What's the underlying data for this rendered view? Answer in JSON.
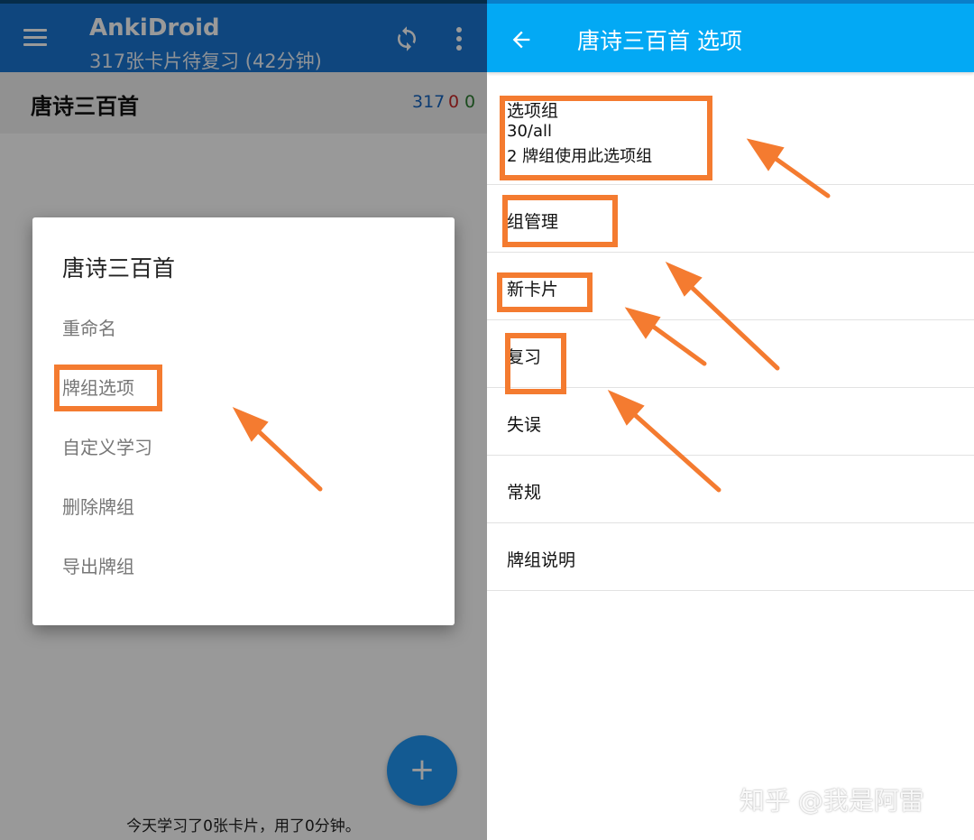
{
  "left_screen": {
    "app_bar": {
      "title": "AnkiDroid",
      "subtitle": "317张卡片待复习 (42分钟)",
      "menu_icon": "menu-icon",
      "sync_icon": "sync-icon",
      "more_icon": "more-vert-icon"
    },
    "deck": {
      "name": "唐诗三百首",
      "due_count": "317",
      "new_count": "0",
      "learning_count": "0"
    },
    "dialog": {
      "title": "唐诗三百首",
      "items": [
        {
          "label": "重命名"
        },
        {
          "label": "牌组选项"
        },
        {
          "label": "自定义学习"
        },
        {
          "label": "删除牌组"
        },
        {
          "label": "导出牌组"
        }
      ]
    },
    "footer_text": "今天学习了0张卡片，用了0分钟。",
    "fab_label": "+"
  },
  "right_screen": {
    "app_bar": {
      "title": "唐诗三百首 选项",
      "back_icon": "arrow-back-icon"
    },
    "options_group": {
      "title": "选项组",
      "value": "30/all",
      "summary": "2 牌组使用此选项组"
    },
    "sections": [
      {
        "label": "组管理"
      },
      {
        "label": "新卡片"
      },
      {
        "label": "复习"
      },
      {
        "label": "失误"
      },
      {
        "label": "常规"
      },
      {
        "label": "牌组说明"
      }
    ]
  },
  "watermark": "知乎 @我是阿雷",
  "colors": {
    "left_app_bar": "#1976d2",
    "right_app_bar": "#03a9f4",
    "fab": "#2196f3",
    "annotation": "#f47b30",
    "due_count": "#1565c0"
  }
}
